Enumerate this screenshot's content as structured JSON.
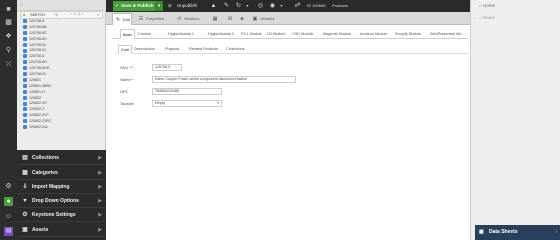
{
  "toolbar": {
    "save_label": "Save & Publish",
    "unpublish_label": "Unpublish",
    "id_text": "ID 183608",
    "breadcrumb": "Products"
  },
  "editor_tabs": [
    {
      "label": "Edit",
      "icon": "pencil-icon"
    },
    {
      "label": "Properties",
      "icon": "list-icon"
    },
    {
      "label": "Versions",
      "icon": "history-icon"
    },
    {
      "label": "",
      "icon": "calendar-icon"
    },
    {
      "label": "",
      "icon": "lock-icon"
    },
    {
      "label": "",
      "icon": "tag-icon"
    },
    {
      "label": "Variants",
      "icon": "variants-icon"
    }
  ],
  "subtabs": [
    "Basic",
    "Custom",
    "Digital Assets 1",
    "Digital Assets 2",
    "PC1 Module",
    "D2 Module",
    "CSD Module",
    "Magento Module",
    "Amazon Module",
    "Shopify Module",
    "WebPresented Mo..."
  ],
  "innertabs": [
    "Core",
    "Descriptions",
    "Physical",
    "Related Products",
    "Collections"
  ],
  "form": {
    "sku_label": "SKU *ⓘ",
    "sku_value": "120708-0",
    "name_label": "Name *",
    "name_value": "Eaton Cooper Power series component disconnect switch",
    "upc_label": "UPC",
    "upc_value": "784500220485",
    "taxable_label": "Taxable",
    "taxable_value": "Empty"
  },
  "tree": {
    "search_value": "SWITCH",
    "items": [
      "120708-6",
      "120708-6B",
      "120708-6C",
      "120708-6H",
      "120708-61",
      "120708-61",
      "120708-8",
      "120708-8H",
      "120708-8HH",
      "120708-51",
      "120801",
      "120801-4BRC",
      "120801-H",
      "120802",
      "120802-2H",
      "120802-2",
      "120802-2LP",
      "120802-21RC",
      "120802-811"
    ]
  },
  "bottom_nav": [
    {
      "label": "Collections",
      "icon": "collections-icon"
    },
    {
      "label": "Categories",
      "icon": "categories-icon"
    },
    {
      "label": "Import Mapping",
      "icon": "import-icon"
    },
    {
      "label": "Drop Down Options",
      "icon": "dropdown-icon"
    },
    {
      "label": "Keystone Settings",
      "icon": "settings-icon"
    },
    {
      "label": "Assets",
      "icon": "assets-icon"
    }
  ],
  "right_panel": {
    "home_top": "Home",
    "home_tab": "Home",
    "datasheets": "Data Sheets"
  },
  "colors": {
    "accent_green": "#4a9d3c",
    "rail": "#2d2d2d",
    "datasheets_bar": "#2a3f5c"
  }
}
